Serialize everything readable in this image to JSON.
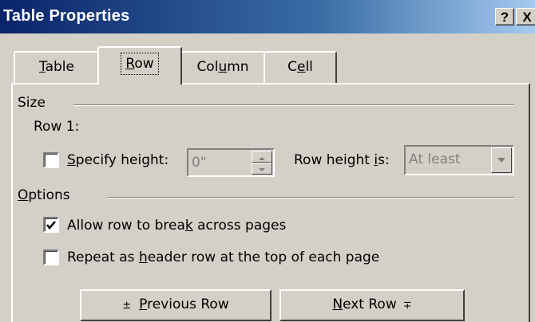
{
  "window": {
    "title": "Table Properties",
    "help_label": "?",
    "close_label": "X"
  },
  "tabs": [
    {
      "pre": "",
      "acc": "T",
      "post": "able"
    },
    {
      "pre": "",
      "acc": "R",
      "post": "ow"
    },
    {
      "pre": "Col",
      "acc": "u",
      "post": "mn"
    },
    {
      "pre": "C",
      "acc": "e",
      "post": "ll"
    }
  ],
  "active_tab": "Row",
  "size_group": {
    "label": "Size",
    "row_label": "Row 1:",
    "specify_height": {
      "pre": "",
      "acc": "S",
      "post": "pecify height:",
      "checked": false
    },
    "height_value": "0\"",
    "row_height_is": {
      "pre": "Row height ",
      "acc": "i",
      "post": "s:"
    },
    "row_height_option": "At least"
  },
  "options_group": {
    "label": {
      "pre": "",
      "acc": "O",
      "post": "ptions"
    },
    "allow_break": {
      "pre": "Allow row to brea",
      "acc": "k",
      "post": " across pages",
      "checked": true
    },
    "repeat_header": {
      "pre": "Repeat as ",
      "acc": "h",
      "post": "eader row at the top of each page",
      "checked": false
    }
  },
  "buttons": {
    "previous": {
      "glyph": "±",
      "pre": "",
      "acc": "P",
      "post": "revious Row"
    },
    "next": {
      "pre": "",
      "acc": "N",
      "post": "ext Row",
      "glyph": "∓"
    }
  }
}
